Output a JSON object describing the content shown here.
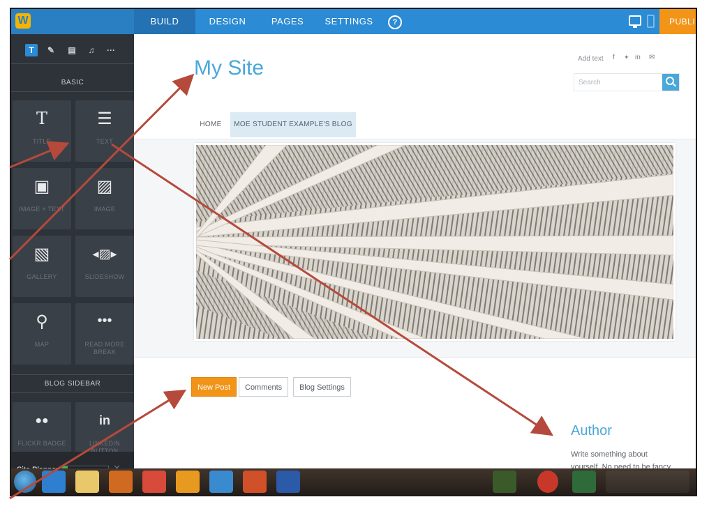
{
  "topbar": {
    "nav": [
      {
        "label": "BUILD",
        "active": true
      },
      {
        "label": "DESIGN",
        "active": false
      },
      {
        "label": "PAGES",
        "active": false
      },
      {
        "label": "SETTINGS",
        "active": false
      }
    ],
    "help_icon": "?",
    "publish_label": "PUBLI",
    "device_icons": [
      "desktop-icon",
      "mobile-icon"
    ]
  },
  "sidebar": {
    "tools": [
      {
        "glyph": "T",
        "icon": "text-tool-icon",
        "active": true
      },
      {
        "glyph": "✎",
        "icon": "pencil-icon",
        "active": false
      },
      {
        "glyph": "▤",
        "icon": "layout-icon",
        "active": false
      },
      {
        "glyph": "♫",
        "icon": "media-icon",
        "active": false
      },
      {
        "glyph": "···",
        "icon": "more-icon",
        "active": false
      }
    ],
    "basic_label": "BASIC",
    "elements": [
      {
        "label": "TITLE",
        "glyph": "T",
        "icon": "title-icon"
      },
      {
        "label": "TEXT",
        "glyph": "☰",
        "icon": "text-icon"
      },
      {
        "label": "IMAGE + TEXT",
        "glyph": "▣",
        "icon": "image-text-icon"
      },
      {
        "label": "IMAGE",
        "glyph": "▨",
        "icon": "image-icon"
      },
      {
        "label": "GALLERY",
        "glyph": "▧",
        "icon": "gallery-icon"
      },
      {
        "label": "SLIDESHOW",
        "glyph": "◂▨▸",
        "icon": "slideshow-icon"
      },
      {
        "label": "MAP",
        "glyph": "⚲",
        "icon": "map-icon"
      },
      {
        "label": "READ MORE BREAK",
        "glyph": "•••",
        "icon": "read-more-icon"
      }
    ],
    "blog_sidebar_label": "BLOG SIDEBAR",
    "blog_elements": [
      {
        "label": "FLICKR BADGE",
        "glyph": "●●",
        "icon": "flickr-icon"
      },
      {
        "label": "LINKEDIN BUTTON",
        "glyph": "in",
        "icon": "linkedin-icon"
      }
    ],
    "planner": {
      "label": "Site Planner",
      "progress": 0.12,
      "close": "✕"
    }
  },
  "site": {
    "title": "My Site",
    "add_text": "Add text",
    "social": [
      {
        "glyph": "f",
        "icon": "facebook-icon"
      },
      {
        "glyph": "🐦",
        "icon": "twitter-icon"
      },
      {
        "glyph": "in",
        "icon": "linkedin-icon"
      },
      {
        "glyph": "✉",
        "icon": "mail-icon"
      }
    ],
    "search_placeholder": "Search",
    "menu": [
      {
        "label": "HOME",
        "active": false
      },
      {
        "label": "MOE STUDENT EXAMPLE'S BLOG",
        "active": true
      }
    ],
    "blog_buttons": [
      {
        "label": "New Post",
        "primary": true
      },
      {
        "label": "Comments",
        "primary": false
      },
      {
        "label": "Blog Settings",
        "primary": false
      }
    ],
    "author_title": "Author",
    "author_text": "Write something about yourself. No need to be fancy, just an overview."
  },
  "taskbar": {
    "apps": [
      {
        "icon": "ie-icon",
        "color": "#2f7fd0"
      },
      {
        "icon": "folder-icon",
        "color": "#e8c86a"
      },
      {
        "icon": "media-player-icon",
        "color": "#d06a20"
      },
      {
        "icon": "chrome-icon",
        "color": "#d84a3a"
      },
      {
        "icon": "outlook-icon",
        "color": "#e89a20"
      },
      {
        "icon": "network-icon",
        "color": "#3a8ad0"
      },
      {
        "icon": "powerpoint-icon",
        "color": "#d0502a"
      },
      {
        "icon": "word-icon",
        "color": "#2a5aa8"
      }
    ]
  },
  "colors": {
    "topbar": "#2b8bd4",
    "sidebar": "#2e3339",
    "accent_orange": "#f19418",
    "title_blue": "#4aa8d8",
    "annotation_arrow": "#b54a3c"
  }
}
